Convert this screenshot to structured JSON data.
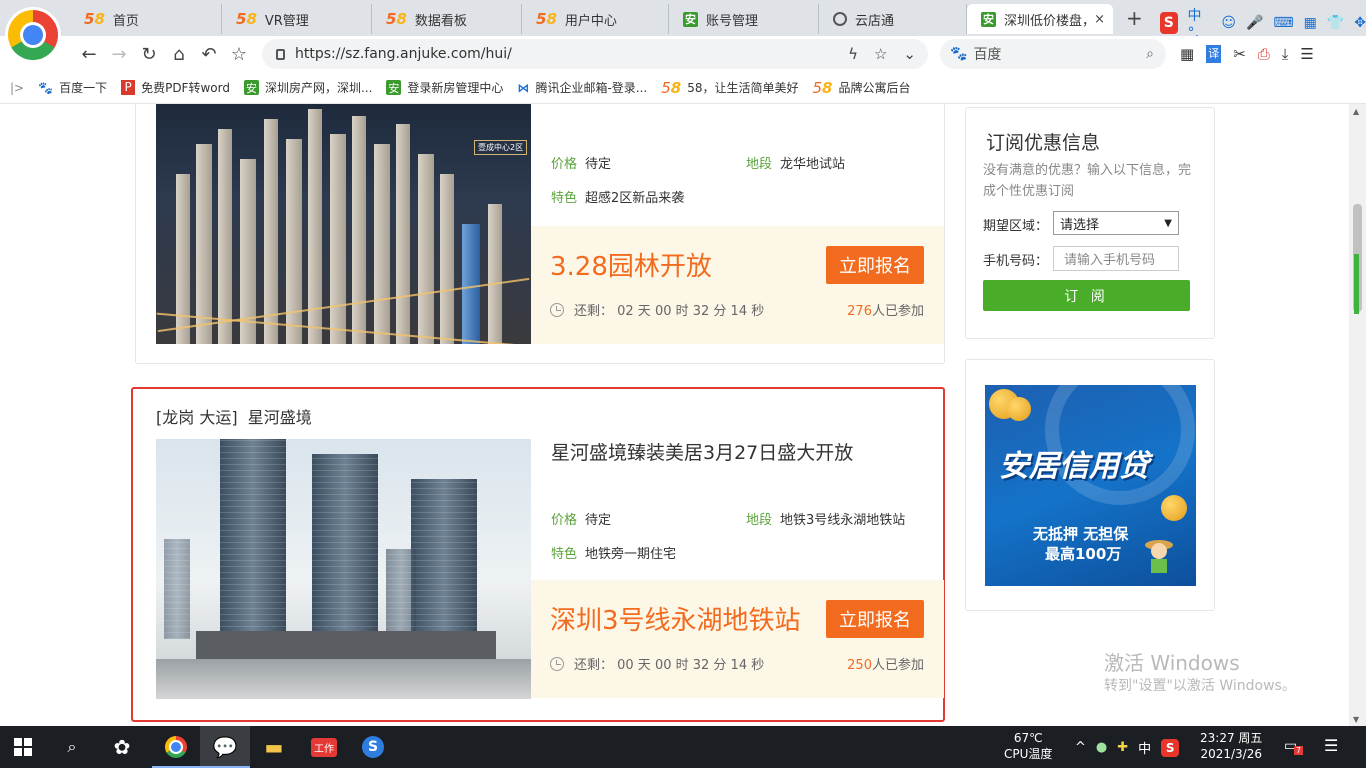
{
  "browser": {
    "tabs": [
      {
        "label": "首页",
        "icon": "58-logo"
      },
      {
        "label": "VR管理",
        "icon": "58-logo"
      },
      {
        "label": "数据看板",
        "icon": "58-logo"
      },
      {
        "label": "用户中心",
        "icon": "58-logo"
      },
      {
        "label": "账号管理",
        "icon": "anjuke-logo"
      },
      {
        "label": "云店通",
        "icon": "globe-icon"
      },
      {
        "label": "深圳低价楼盘，",
        "icon": "anjuke-logo",
        "active": true
      }
    ],
    "new_tab": "+",
    "close_tab": "×",
    "ime": {
      "logo": "S",
      "text": "中 °,"
    },
    "url": "https://sz.fang.anjuke.com/hui/",
    "search_placeholder": "百度",
    "bookmarks_toggle": "|>",
    "bookmarks": [
      {
        "label": "百度一下",
        "icon": "baidu-icon"
      },
      {
        "label": "免费PDF转word",
        "icon": "pdf-icon"
      },
      {
        "label": "深圳房产网，深圳...",
        "icon": "anjuke-logo"
      },
      {
        "label": "登录新房管理中心",
        "icon": "anjuke-logo"
      },
      {
        "label": "腾讯企业邮箱-登录...",
        "icon": "tencent-mail-icon"
      },
      {
        "label": "58，让生活简单美好",
        "icon": "58-logo"
      },
      {
        "label": "品牌公寓后台",
        "icon": "58-logo"
      }
    ]
  },
  "listings": [
    {
      "price_label": "价格",
      "price": "待定",
      "location_label": "地段",
      "location": "龙华地试站",
      "feature_label": "特色",
      "feature": "超感2区新品来袭",
      "photo_tag": "壹成中心2区",
      "promo_title": "3.28园林开放",
      "cta": "立即报名",
      "countdown": "还剩： 02 天 00 时 32 分 14 秒",
      "joined_count": "276",
      "joined_suffix": "人已参加"
    },
    {
      "district": "[龙岗 大运]",
      "name": "星河盛境",
      "headline": "星河盛境臻装美居3月27日盛大开放",
      "price_label": "价格",
      "price": "待定",
      "location_label": "地段",
      "location": "地铁3号线永湖地铁站",
      "feature_label": "特色",
      "feature": "地铁旁一期住宅",
      "promo_title": "深圳3号线永湖地铁站",
      "cta": "立即报名",
      "countdown": "还剩： 00 天 00 时 32 分 14 秒",
      "joined_count": "250",
      "joined_suffix": "人已参加"
    }
  ],
  "subscribe": {
    "title": "订阅优惠信息",
    "description": "没有满意的优惠？输入以下信息，完成个性优惠订阅",
    "region_label": "期望区域：",
    "region_value": "请选择",
    "phone_label": "手机号码：",
    "phone_placeholder": "请输入手机号码",
    "submit": "订 阅"
  },
  "ad": {
    "title": "安居信用贷",
    "line1": "无抵押 无担保",
    "line2": "最高100万"
  },
  "watermark": {
    "line1": "激活 Windows",
    "line2": "转到\"设置\"以激活 Windows。"
  },
  "taskbar": {
    "temp": "67℃",
    "temp_label": "CPU温度",
    "ime": "中",
    "time": "23:27 周五",
    "date": "2021/3/26",
    "notif_count": "7"
  },
  "colors": {
    "accent_orange": "#f26b1f",
    "label_green": "#5ba33c",
    "subscribe_green": "#4aad29",
    "highlight_red": "#e23a33"
  }
}
